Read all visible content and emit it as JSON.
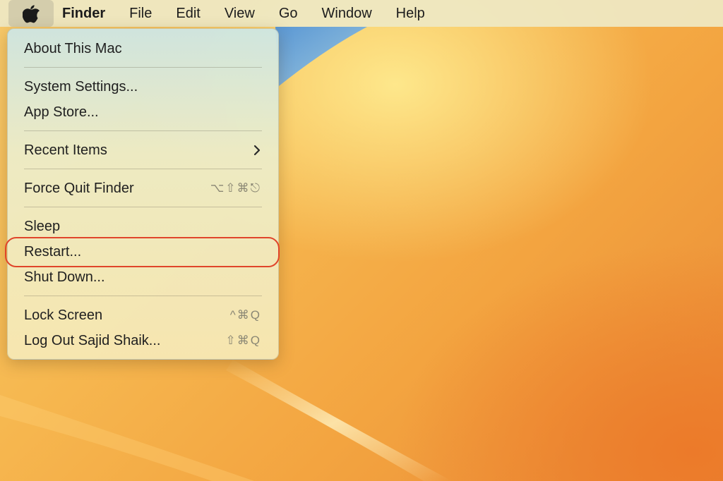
{
  "menubar": {
    "apple_icon": "apple-logo-icon",
    "app_name": "Finder",
    "items": [
      {
        "label": "File"
      },
      {
        "label": "Edit"
      },
      {
        "label": "View"
      },
      {
        "label": "Go"
      },
      {
        "label": "Window"
      },
      {
        "label": "Help"
      }
    ]
  },
  "apple_menu": {
    "about": {
      "label": "About This Mac"
    },
    "system_settings": {
      "label": "System Settings..."
    },
    "app_store": {
      "label": "App Store..."
    },
    "recent_items": {
      "label": "Recent Items",
      "icon": "chevron-right-icon"
    },
    "force_quit": {
      "label": "Force Quit Finder",
      "shortcut": "⌥⇧⌘⎋"
    },
    "sleep": {
      "label": "Sleep"
    },
    "restart": {
      "label": "Restart..."
    },
    "shut_down": {
      "label": "Shut Down..."
    },
    "lock_screen": {
      "label": "Lock Screen",
      "shortcut": "^⌘Q"
    },
    "log_out": {
      "label": "Log Out Sajid Shaik...",
      "shortcut": "⇧⌘Q"
    }
  },
  "annotation": {
    "highlight_color": "#e0452a",
    "highlighted_item": "Restart..."
  },
  "colors": {
    "menubar_bg": "#eee8c4",
    "wallpaper_primary": "#f6b850",
    "wallpaper_accent_blue": "#5b9ee0"
  }
}
